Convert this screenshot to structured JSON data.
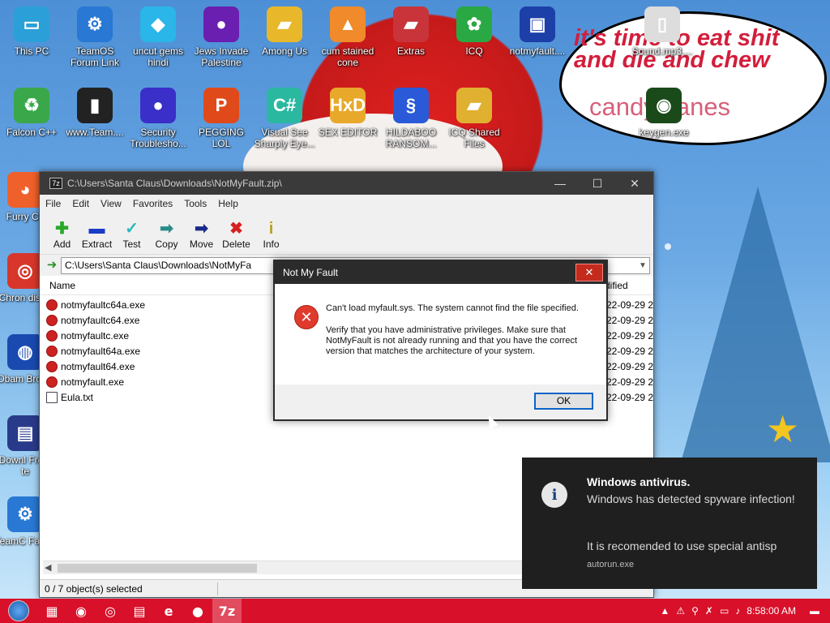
{
  "desktop": {
    "speech_text": "it's time to eat shit and die and chew",
    "speech_text2": "candy canes",
    "icons": [
      {
        "label": "This PC",
        "icon": "monitor-icon",
        "color": "#2a9fd8"
      },
      {
        "label": "TeamOS Forum Link",
        "icon": "gear-icon",
        "color": "#2878d4"
      },
      {
        "label": "uncut gems hindi",
        "icon": "gem-icon",
        "color": "#2ab6e8"
      },
      {
        "label": "Jews Invade Palestine",
        "icon": "orb-icon",
        "color": "#6a1fb0"
      },
      {
        "label": "Among Us",
        "icon": "folder-icon",
        "color": "#e8b82a"
      },
      {
        "label": "cum stained cone",
        "icon": "cone-icon",
        "color": "#f08a2a"
      },
      {
        "label": "Extras",
        "icon": "folder-icon",
        "color": "#c8343a"
      },
      {
        "label": "ICQ",
        "icon": "flower-icon",
        "color": "#2aa844"
      },
      {
        "label": "notmyfault....",
        "icon": "screen-icon",
        "color": "#1d3fa8"
      },
      {
        "label": "Sound.mp3....",
        "icon": "file-icon",
        "color": "#dddddd"
      },
      {
        "label": "Falcon C++",
        "icon": "recycle-icon",
        "color": "#3aa84a"
      },
      {
        "label": "www.Team....",
        "icon": "book-icon",
        "color": "#222222"
      },
      {
        "label": "Security Troublesho...",
        "icon": "orb-icon",
        "color": "#3a2fc8"
      },
      {
        "label": "PEGGING LOL",
        "icon": "p-icon",
        "color": "#e04a1a"
      },
      {
        "label": "Visual See Sharply Eye...",
        "icon": "csharp-icon",
        "color": "#2ab8a0"
      },
      {
        "label": "SEX EDITOR",
        "icon": "hex-icon",
        "color": "#e8a82a"
      },
      {
        "label": "HILDABOO RANSOM...",
        "icon": "script-icon",
        "color": "#2a5ad8"
      },
      {
        "label": "ICQ Shared Files",
        "icon": "folder-icon",
        "color": "#e0b030"
      },
      {
        "label": "keygen.exe",
        "icon": "eye-icon",
        "color": "#1a4a1a"
      },
      {
        "label": "Furry Co",
        "icon": "firefox-icon",
        "color": "#f0602a"
      },
      {
        "label": "Chron disea",
        "icon": "chrome-icon",
        "color": "#d8362a"
      },
      {
        "label": "Obam Brows",
        "icon": "obama-icon",
        "color": "#1a4ab0"
      },
      {
        "label": "Downl From te",
        "icon": "scroll-icon",
        "color": "#2a3a8a"
      },
      {
        "label": "TeamC Faceb",
        "icon": "gear-icon",
        "color": "#2878d4"
      }
    ]
  },
  "zip_window": {
    "title": "C:\\Users\\Santa Claus\\Downloads\\NotMyFault.zip\\",
    "menu": [
      "File",
      "Edit",
      "View",
      "Favorites",
      "Tools",
      "Help"
    ],
    "toolbar": [
      {
        "label": "Add",
        "icon": "plus-icon",
        "color": "#2aa82a",
        "glyph": "✚"
      },
      {
        "label": "Extract",
        "icon": "minus-icon",
        "color": "#1a3ac8",
        "glyph": "▬"
      },
      {
        "label": "Test",
        "icon": "check-icon",
        "color": "#2ab8b8",
        "glyph": "✓"
      },
      {
        "label": "Copy",
        "icon": "copy-arrow-icon",
        "color": "#2a8a8a",
        "glyph": "➡"
      },
      {
        "label": "Move",
        "icon": "move-arrow-icon",
        "color": "#1a2a8a",
        "glyph": "➡"
      },
      {
        "label": "Delete",
        "icon": "delete-x-icon",
        "color": "#d82020",
        "glyph": "✖"
      },
      {
        "label": "Info",
        "icon": "info-icon",
        "color": "#b8a020",
        "glyph": "i"
      }
    ],
    "address": "C:\\Users\\Santa Claus\\Downloads\\NotMyFa",
    "col_name": "Name",
    "col_modified": "dified",
    "files": [
      {
        "name": "notmyfaultc64a.exe",
        "date": "22-09-29 2",
        "type": "exe"
      },
      {
        "name": "notmyfaultc64.exe",
        "date": "22-09-29 2",
        "type": "exe"
      },
      {
        "name": "notmyfaultc.exe",
        "date": "22-09-29 2",
        "type": "exe"
      },
      {
        "name": "notmyfault64a.exe",
        "date": "22-09-29 2",
        "type": "exe"
      },
      {
        "name": "notmyfault64.exe",
        "date": "22-09-29 2",
        "type": "exe"
      },
      {
        "name": "notmyfault.exe",
        "date": "22-09-29 2",
        "type": "exe"
      },
      {
        "name": "Eula.txt",
        "date": "22-09-29 2",
        "type": "txt"
      }
    ],
    "status": "0 / 7 object(s) selected"
  },
  "dialog": {
    "title": "Not My Fault",
    "message1": "Can't load myfault.sys. The system cannot find the file specified.",
    "message2": "Verify that you have administrative privileges. Make sure that NotMyFault is not already running and that you have the correct version that matches the architecture of your system.",
    "ok_label": "OK"
  },
  "toast": {
    "title": "Windows antivirus.",
    "message": "Windows has detected spyware infection!",
    "message2": "It is recomended to use special antisp",
    "source": "autorun.exe"
  },
  "taskbar": {
    "items": [
      {
        "icon": "task-view-icon",
        "glyph": "▦"
      },
      {
        "icon": "firefox-icon",
        "glyph": "◉"
      },
      {
        "icon": "chrome-icon",
        "glyph": "◎"
      },
      {
        "icon": "file-explorer-icon",
        "glyph": "▤"
      },
      {
        "icon": "internet-explorer-icon",
        "glyph": "e"
      },
      {
        "icon": "notmyfault-icon",
        "glyph": "●"
      },
      {
        "icon": "7zip-icon",
        "glyph": "7z"
      }
    ],
    "clock": "8:58:00 AM"
  }
}
